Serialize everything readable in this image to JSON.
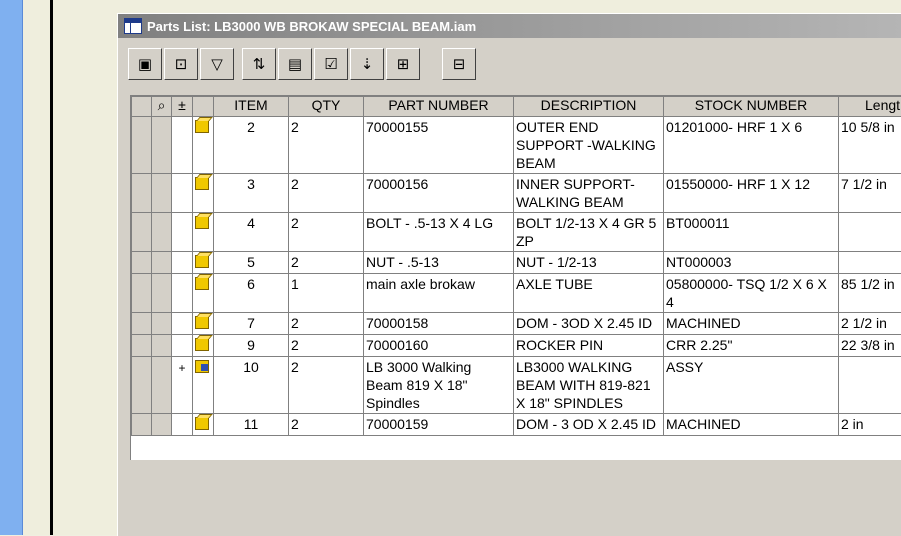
{
  "window": {
    "title": "Parts List: LB3000 WB BROKAW SPECIAL BEAM.iam"
  },
  "toolbar": {
    "buttons": [
      {
        "name": "filter-settings-button",
        "glyph": "▣"
      },
      {
        "name": "export-button",
        "glyph": "⊡"
      },
      {
        "name": "filter-button",
        "glyph": "▽"
      },
      {
        "name": "sort-button",
        "glyph": "⇅"
      },
      {
        "name": "column-chooser-button",
        "glyph": "▤"
      },
      {
        "name": "properties-button",
        "glyph": "☑"
      },
      {
        "name": "renumber-button",
        "glyph": "⇣"
      },
      {
        "name": "group-button",
        "glyph": "⊞"
      },
      {
        "name": "column-settings-button",
        "glyph": "⊟"
      }
    ]
  },
  "grid": {
    "header_icons": {
      "col1": "⌕",
      "col2": "±"
    },
    "columns": [
      "ITEM",
      "QTY",
      "PART NUMBER",
      "DESCRIPTION",
      "STOCK NUMBER",
      "Lengt"
    ],
    "rows": [
      {
        "icon": "part",
        "expand": "",
        "item": "2",
        "qty": "2",
        "part": "70000155",
        "desc": "OUTER END SUPPORT -WALKING BEAM",
        "stock": "01201000- HRF 1 X 6",
        "length": "10 5/8 in"
      },
      {
        "icon": "part",
        "expand": "",
        "item": "3",
        "qty": "2",
        "part": "70000156",
        "desc": "INNER SUPPORT-WALKING BEAM",
        "stock": "01550000- HRF 1 X 12",
        "length": "7 1/2 in"
      },
      {
        "icon": "part",
        "expand": "",
        "item": "4",
        "qty": "2",
        "part": "BOLT - .5-13 X 4 LG",
        "desc": "BOLT 1/2-13 X 4 GR 5 ZP",
        "stock": "BT000011",
        "length": ""
      },
      {
        "icon": "part",
        "expand": "",
        "item": "5",
        "qty": "2",
        "part": "NUT - .5-13",
        "desc": "NUT - 1/2-13",
        "stock": "NT000003",
        "length": ""
      },
      {
        "icon": "part",
        "expand": "",
        "item": "6",
        "qty": "1",
        "part": "main axle brokaw",
        "desc": "AXLE TUBE",
        "stock": "05800000-  TSQ 1/2 X 6 X 4",
        "length": "85 1/2 in"
      },
      {
        "icon": "part",
        "expand": "",
        "item": "7",
        "qty": "2",
        "part": "70000158",
        "desc": "DOM - 3OD X 2.45 ID",
        "stock": "MACHINED",
        "length": "2 1/2 in"
      },
      {
        "icon": "part",
        "expand": "",
        "item": "9",
        "qty": "2",
        "part": "70000160",
        "desc": "ROCKER PIN",
        "stock": "CRR 2.25\"",
        "length": "22 3/8 in"
      },
      {
        "icon": "assembly",
        "expand": "+",
        "item": "10",
        "qty": "2",
        "part": "LB 3000 Walking Beam 819 X 18\" Spindles",
        "desc": "LB3000 WALKING BEAM WITH 819-821 X 18\" SPINDLES",
        "stock": "ASSY",
        "length": ""
      },
      {
        "icon": "part",
        "expand": "",
        "item": "11",
        "qty": "2",
        "part": "70000159",
        "desc": "DOM - 3 OD X 2.45 ID",
        "stock": "MACHINED",
        "length": "2 in"
      }
    ]
  }
}
